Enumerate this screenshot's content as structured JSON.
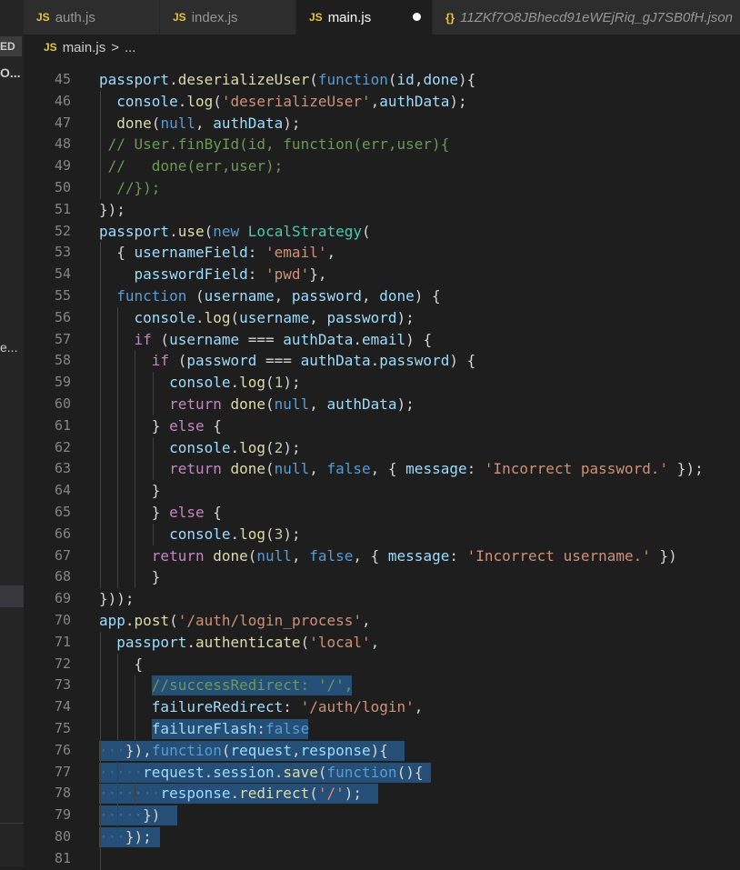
{
  "tabs": [
    {
      "icon": "JS",
      "label": "auth.js",
      "active": false
    },
    {
      "icon": "JS",
      "label": "index.js",
      "active": false
    },
    {
      "icon": "JS",
      "label": "main.js",
      "active": true,
      "modified": true
    },
    {
      "icon": "{}",
      "label": "11ZKf7O8JBhecd91eWEjRiq_gJ7SB0fH.json",
      "active": false
    }
  ],
  "breadcrumb": {
    "icon": "JS",
    "file": "main.js",
    "separator": ">",
    "rest": "..."
  },
  "explorer": {
    "header": "ED",
    "item1": "O...",
    "item2": "e..."
  },
  "editor": {
    "lines": [
      {
        "n": "45",
        "tokens": [
          [
            "var",
            "passport"
          ],
          [
            "p",
            "."
          ],
          [
            "fn",
            "deserializeUser"
          ],
          [
            "p",
            "("
          ],
          [
            "kw",
            "function"
          ],
          [
            "p",
            "("
          ],
          [
            "var",
            "id"
          ],
          [
            "p",
            ","
          ],
          [
            "var",
            "done"
          ],
          [
            "p",
            "){"
          ]
        ]
      },
      {
        "n": "46",
        "tokens": [
          [
            "p",
            "  "
          ],
          [
            "var",
            "console"
          ],
          [
            "p",
            "."
          ],
          [
            "fn",
            "log"
          ],
          [
            "p",
            "("
          ],
          [
            "str",
            "'deserializeUser'"
          ],
          [
            "p",
            ","
          ],
          [
            "var",
            "authData"
          ],
          [
            "p",
            ");"
          ]
        ]
      },
      {
        "n": "47",
        "tokens": [
          [
            "p",
            "  "
          ],
          [
            "fn",
            "done"
          ],
          [
            "p",
            "("
          ],
          [
            "kw",
            "null"
          ],
          [
            "p",
            ", "
          ],
          [
            "var",
            "authData"
          ],
          [
            "p",
            ");"
          ]
        ]
      },
      {
        "n": "48",
        "tokens": [
          [
            "p",
            " "
          ],
          [
            "cmt",
            "// User.finById(id, function(err,user){"
          ]
        ]
      },
      {
        "n": "49",
        "tokens": [
          [
            "p",
            " "
          ],
          [
            "cmt",
            "//   done(err,user);"
          ]
        ]
      },
      {
        "n": "50",
        "tokens": [
          [
            "p",
            "  "
          ],
          [
            "cmt",
            "//});"
          ]
        ]
      },
      {
        "n": "51",
        "tokens": [
          [
            "p",
            "});"
          ]
        ]
      },
      {
        "n": "52",
        "tokens": [
          [
            "var",
            "passport"
          ],
          [
            "p",
            "."
          ],
          [
            "fn",
            "use"
          ],
          [
            "p",
            "("
          ],
          [
            "kw",
            "new"
          ],
          [
            "p",
            " "
          ],
          [
            "cls",
            "LocalStrategy"
          ],
          [
            "p",
            "("
          ]
        ]
      },
      {
        "n": "53",
        "tokens": [
          [
            "p",
            "  { "
          ],
          [
            "var",
            "usernameField"
          ],
          [
            "p",
            ": "
          ],
          [
            "str",
            "'email'"
          ],
          [
            "p",
            ","
          ]
        ]
      },
      {
        "n": "54",
        "tokens": [
          [
            "p",
            "    "
          ],
          [
            "var",
            "passwordField"
          ],
          [
            "p",
            ": "
          ],
          [
            "str",
            "'pwd'"
          ],
          [
            "p",
            "},"
          ]
        ]
      },
      {
        "n": "55",
        "tokens": [
          [
            "p",
            "  "
          ],
          [
            "kw",
            "function"
          ],
          [
            "p",
            " ("
          ],
          [
            "var",
            "username"
          ],
          [
            "p",
            ", "
          ],
          [
            "var",
            "password"
          ],
          [
            "p",
            ", "
          ],
          [
            "var",
            "done"
          ],
          [
            "p",
            ") {"
          ]
        ]
      },
      {
        "n": "56",
        "tokens": [
          [
            "p",
            "    "
          ],
          [
            "var",
            "console"
          ],
          [
            "p",
            "."
          ],
          [
            "fn",
            "log"
          ],
          [
            "p",
            "("
          ],
          [
            "var",
            "username"
          ],
          [
            "p",
            ", "
          ],
          [
            "var",
            "password"
          ],
          [
            "p",
            ");"
          ]
        ]
      },
      {
        "n": "57",
        "tokens": [
          [
            "p",
            "    "
          ],
          [
            "ctl",
            "if"
          ],
          [
            "p",
            " ("
          ],
          [
            "var",
            "username"
          ],
          [
            "p",
            " === "
          ],
          [
            "var",
            "authData"
          ],
          [
            "p",
            "."
          ],
          [
            "var",
            "email"
          ],
          [
            "p",
            ") {"
          ]
        ]
      },
      {
        "n": "58",
        "tokens": [
          [
            "p",
            "      "
          ],
          [
            "ctl",
            "if"
          ],
          [
            "p",
            " ("
          ],
          [
            "var",
            "password"
          ],
          [
            "p",
            " === "
          ],
          [
            "var",
            "authData"
          ],
          [
            "p",
            "."
          ],
          [
            "var",
            "password"
          ],
          [
            "p",
            ") {"
          ]
        ]
      },
      {
        "n": "59",
        "tokens": [
          [
            "p",
            "        "
          ],
          [
            "var",
            "console"
          ],
          [
            "p",
            "."
          ],
          [
            "fn",
            "log"
          ],
          [
            "p",
            "("
          ],
          [
            "num",
            "1"
          ],
          [
            "p",
            ");"
          ]
        ]
      },
      {
        "n": "60",
        "tokens": [
          [
            "p",
            "        "
          ],
          [
            "ctl",
            "return"
          ],
          [
            "p",
            " "
          ],
          [
            "fn",
            "done"
          ],
          [
            "p",
            "("
          ],
          [
            "kw",
            "null"
          ],
          [
            "p",
            ", "
          ],
          [
            "var",
            "authData"
          ],
          [
            "p",
            ");"
          ]
        ]
      },
      {
        "n": "61",
        "tokens": [
          [
            "p",
            "      } "
          ],
          [
            "ctl",
            "else"
          ],
          [
            "p",
            " {"
          ]
        ]
      },
      {
        "n": "62",
        "tokens": [
          [
            "p",
            "        "
          ],
          [
            "var",
            "console"
          ],
          [
            "p",
            "."
          ],
          [
            "fn",
            "log"
          ],
          [
            "p",
            "("
          ],
          [
            "num",
            "2"
          ],
          [
            "p",
            ");"
          ]
        ]
      },
      {
        "n": "63",
        "tokens": [
          [
            "p",
            "        "
          ],
          [
            "ctl",
            "return"
          ],
          [
            "p",
            " "
          ],
          [
            "fn",
            "done"
          ],
          [
            "p",
            "("
          ],
          [
            "kw",
            "null"
          ],
          [
            "p",
            ", "
          ],
          [
            "kw",
            "false"
          ],
          [
            "p",
            ", { "
          ],
          [
            "var",
            "message"
          ],
          [
            "p",
            ": "
          ],
          [
            "str",
            "'Incorrect password.'"
          ],
          [
            "p",
            " });"
          ]
        ]
      },
      {
        "n": "64",
        "tokens": [
          [
            "p",
            "      }"
          ]
        ]
      },
      {
        "n": "65",
        "tokens": [
          [
            "p",
            "      } "
          ],
          [
            "ctl",
            "else"
          ],
          [
            "p",
            " {"
          ]
        ]
      },
      {
        "n": "66",
        "tokens": [
          [
            "p",
            "        "
          ],
          [
            "var",
            "console"
          ],
          [
            "p",
            "."
          ],
          [
            "fn",
            "log"
          ],
          [
            "p",
            "("
          ],
          [
            "num",
            "3"
          ],
          [
            "p",
            ");"
          ]
        ]
      },
      {
        "n": "67",
        "tokens": [
          [
            "p",
            "      "
          ],
          [
            "ctl",
            "return"
          ],
          [
            "p",
            " "
          ],
          [
            "fn",
            "done"
          ],
          [
            "p",
            "("
          ],
          [
            "kw",
            "null"
          ],
          [
            "p",
            ", "
          ],
          [
            "kw",
            "false"
          ],
          [
            "p",
            ", { "
          ],
          [
            "var",
            "message"
          ],
          [
            "p",
            ": "
          ],
          [
            "str",
            "'Incorrect username.'"
          ],
          [
            "p",
            " })"
          ]
        ]
      },
      {
        "n": "68",
        "tokens": [
          [
            "p",
            "      }"
          ]
        ]
      },
      {
        "n": "69",
        "tokens": [
          [
            "p",
            "}));"
          ]
        ]
      },
      {
        "n": "70",
        "tokens": [
          [
            "var",
            "app"
          ],
          [
            "p",
            "."
          ],
          [
            "fn",
            "post"
          ],
          [
            "p",
            "("
          ],
          [
            "str",
            "'/auth/login_process'"
          ],
          [
            "p",
            ","
          ]
        ]
      },
      {
        "n": "71",
        "tokens": [
          [
            "p",
            "  "
          ],
          [
            "var",
            "passport"
          ],
          [
            "p",
            "."
          ],
          [
            "fn",
            "authenticate"
          ],
          [
            "p",
            "("
          ],
          [
            "str",
            "'local'"
          ],
          [
            "p",
            ","
          ]
        ]
      },
      {
        "n": "72",
        "tokens": [
          [
            "p",
            "    {"
          ]
        ]
      },
      {
        "n": "73",
        "tokens": [
          [
            "p",
            "      "
          ],
          [
            "cmt",
            "//successRedirect: '/',"
          ]
        ]
      },
      {
        "n": "74",
        "tokens": [
          [
            "p",
            "      "
          ],
          [
            "var",
            "failureRedirect"
          ],
          [
            "p",
            ": "
          ],
          [
            "str",
            "'/auth/login'"
          ],
          [
            "p",
            ","
          ]
        ]
      },
      {
        "n": "75",
        "tokens": [
          [
            "p",
            "      "
          ],
          [
            "var",
            "failureFlash"
          ],
          [
            "p",
            ":"
          ],
          [
            "kw",
            "false"
          ]
        ]
      },
      {
        "n": "76",
        "tokens": [
          [
            "ws",
            "···"
          ],
          [
            "p",
            "}),"
          ],
          [
            "kw",
            "function"
          ],
          [
            "p",
            "("
          ],
          [
            "var",
            "request"
          ],
          [
            "p",
            ","
          ],
          [
            "var",
            "response"
          ],
          [
            "p",
            "){"
          ]
        ]
      },
      {
        "n": "77",
        "tokens": [
          [
            "ws",
            "·····"
          ],
          [
            "var",
            "request"
          ],
          [
            "p",
            "."
          ],
          [
            "var",
            "session"
          ],
          [
            "p",
            "."
          ],
          [
            "fn",
            "save"
          ],
          [
            "p",
            "("
          ],
          [
            "kw",
            "function"
          ],
          [
            "p",
            "(){"
          ]
        ]
      },
      {
        "n": "78",
        "tokens": [
          [
            "ws",
            "·······"
          ],
          [
            "var",
            "response"
          ],
          [
            "p",
            "."
          ],
          [
            "fn",
            "redirect"
          ],
          [
            "p",
            "("
          ],
          [
            "str",
            "'/'"
          ],
          [
            "p",
            ");"
          ]
        ]
      },
      {
        "n": "79",
        "tokens": [
          [
            "ws",
            "·····"
          ],
          [
            "p",
            "})"
          ]
        ]
      },
      {
        "n": "80",
        "tokens": [
          [
            "ws",
            "···"
          ],
          [
            "p",
            "});"
          ]
        ]
      },
      {
        "n": "81",
        "tokens": []
      }
    ]
  }
}
